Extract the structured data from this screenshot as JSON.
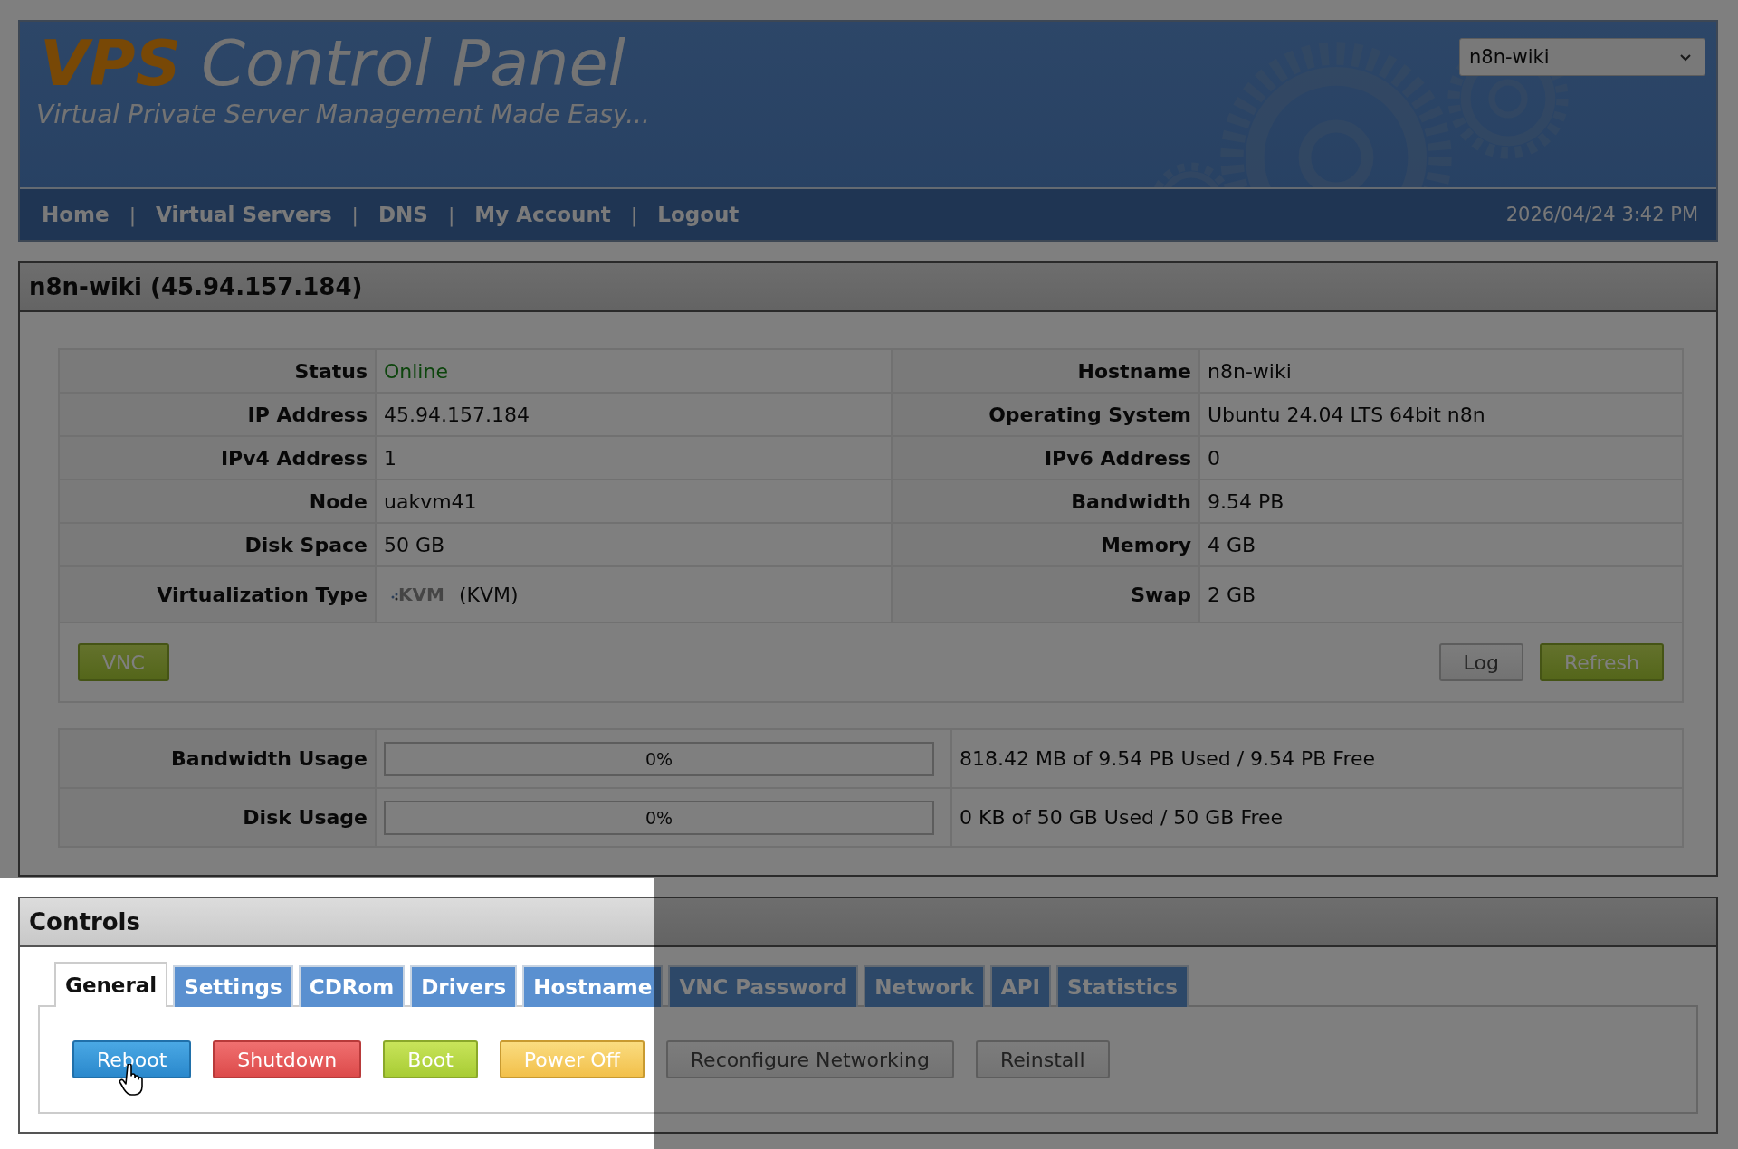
{
  "header": {
    "brand": "VPS",
    "title": "Control Panel",
    "tagline": "Virtual Private Server Management Made Easy...",
    "server_select": {
      "value": "n8n-wiki"
    }
  },
  "nav": {
    "links": [
      "Home",
      "Virtual Servers",
      "DNS",
      "My Account",
      "Logout"
    ],
    "separator": "|",
    "datetime": "2026/04/24 3:42 PM"
  },
  "server_panel": {
    "title": "n8n-wiki (45.94.157.184)",
    "info_rows": [
      {
        "left": {
          "label": "Status",
          "value": "Online",
          "kind": "status"
        },
        "right": {
          "label": "Hostname",
          "value": "n8n-wiki",
          "kind": "text"
        }
      },
      {
        "left": {
          "label": "IP Address",
          "value": "45.94.157.184",
          "kind": "text"
        },
        "right": {
          "label": "Operating System",
          "value": "Ubuntu 24.04 LTS 64bit n8n",
          "kind": "text"
        }
      },
      {
        "left": {
          "label": "IPv4 Address",
          "value": "1",
          "kind": "text"
        },
        "right": {
          "label": "IPv6 Address",
          "value": "0",
          "kind": "text"
        }
      },
      {
        "left": {
          "label": "Node",
          "value": "uakvm41",
          "kind": "text"
        },
        "right": {
          "label": "Bandwidth",
          "value": "9.54 PB",
          "kind": "text"
        }
      },
      {
        "left": {
          "label": "Disk Space",
          "value": "50 GB",
          "kind": "text"
        },
        "right": {
          "label": "Memory",
          "value": "4 GB",
          "kind": "text"
        }
      },
      {
        "left": {
          "label": "Virtualization Type",
          "value": "(KVM)",
          "logo": "KVM",
          "kind": "logo"
        },
        "right": {
          "label": "Swap",
          "value": "2 GB",
          "kind": "text"
        }
      }
    ],
    "left_buttons": [
      {
        "label": "VNC",
        "kind": "success"
      }
    ],
    "right_buttons": [
      {
        "label": "Log",
        "kind": "default"
      },
      {
        "label": "Refresh",
        "kind": "success"
      }
    ],
    "usage": [
      {
        "label": "Bandwidth Usage",
        "level": 0,
        "percent": "0%",
        "detail": "818.42 MB of 9.54 PB Used / 9.54 PB Free"
      },
      {
        "label": "Disk Usage",
        "level": 0,
        "percent": "0%",
        "detail": "0 KB of 50 GB Used / 50 GB Free"
      }
    ]
  },
  "controls": {
    "title": "Controls",
    "tabs": [
      {
        "label": "General",
        "selected": true
      },
      {
        "label": "Settings",
        "selected": false
      },
      {
        "label": "CDRom",
        "selected": false
      },
      {
        "label": "Drivers",
        "selected": false
      },
      {
        "label": "Hostname",
        "selected": false
      },
      {
        "label": "VNC Password",
        "selected": false
      },
      {
        "label": "Network",
        "selected": false
      },
      {
        "label": "API",
        "selected": false
      },
      {
        "label": "Statistics",
        "selected": false
      }
    ],
    "buttons": [
      {
        "label": "Reboot",
        "kind": "primary",
        "hovered": true
      },
      {
        "label": "Shutdown",
        "kind": "danger",
        "hovered": false
      },
      {
        "label": "Boot",
        "kind": "success",
        "hovered": false
      },
      {
        "label": "Power Off",
        "kind": "warning",
        "hovered": false
      },
      {
        "label": "Reconfigure Networking",
        "kind": "default",
        "hovered": false
      },
      {
        "label": "Reinstall",
        "kind": "default",
        "hovered": false
      }
    ]
  },
  "spotlight": {
    "on": true
  }
}
